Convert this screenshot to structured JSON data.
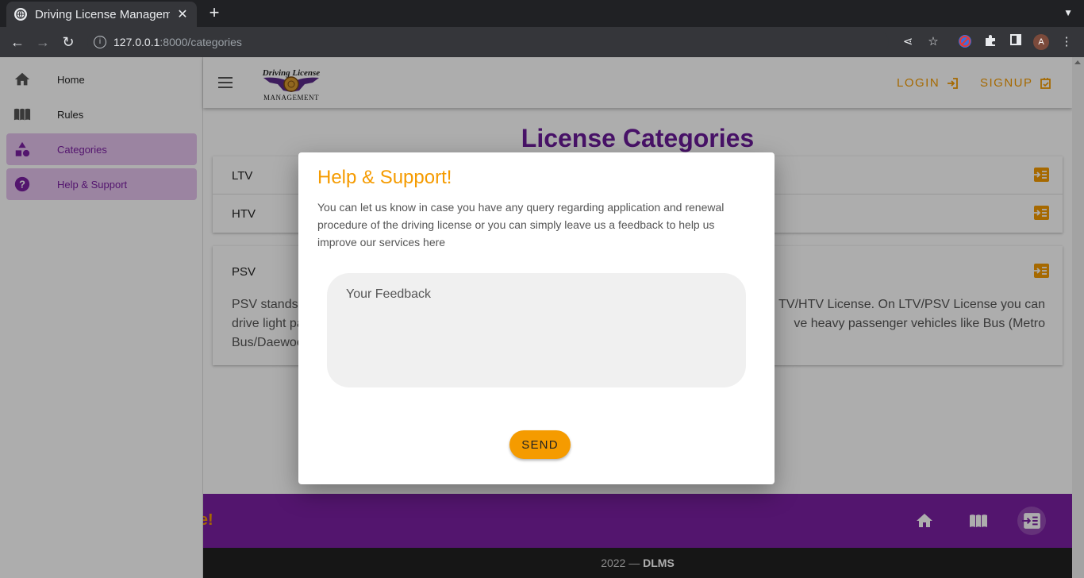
{
  "browser": {
    "tab_title": "Driving License Management",
    "url_host": "127.0.0.1",
    "url_path": ":8000/categories",
    "avatar_letter": "A"
  },
  "sidebar": {
    "items": [
      {
        "label": "Home",
        "icon": "home-icon"
      },
      {
        "label": "Rules",
        "icon": "book-icon"
      },
      {
        "label": "Categories",
        "icon": "shapes-icon",
        "active": true
      },
      {
        "label": "Help & Support",
        "icon": "help-icon",
        "active": true
      }
    ]
  },
  "appbar": {
    "logo_line1": "Driving License",
    "logo_line2": "MANAGEMENT",
    "login_label": "LOGIN",
    "signup_label": "SIGNUP"
  },
  "page": {
    "title": "License Categories",
    "categories": [
      "LTV",
      "HTV"
    ],
    "psv_label": "PSV",
    "psv_description_left": "PSV stands",
    "psv_description_right": "TV/HTV License. On LTV/PSV License you can",
    "psv_line2_left": "drive light pa",
    "psv_line2_right": "ve heavy passenger vehicles like Bus (Metro",
    "psv_line3_left": "Bus/Daewoo"
  },
  "footer": {
    "slogan": "Drive!",
    "year": "2022 —",
    "brand": "DLMS"
  },
  "dialog": {
    "title": "Help & Support!",
    "text": "You can let us know in case you have any query regarding application and renewal procedure of the driving license or you can simply leave us a feedback to help us improve our services here",
    "feedback_placeholder": "Your Feedback",
    "send_label": "SEND"
  },
  "colors": {
    "accent": "#f59b00",
    "purple": "#7b1fa2",
    "title_purple": "#6a1b9a",
    "active_bg": "#e5c3ee"
  }
}
